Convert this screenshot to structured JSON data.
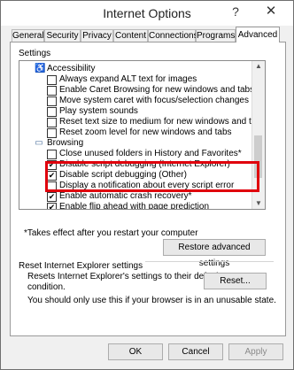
{
  "window": {
    "title": "Internet Options",
    "help_icon": "?",
    "close_icon": "✕"
  },
  "tabs": [
    "General",
    "Security",
    "Privacy",
    "Content",
    "Connections",
    "Programs",
    "Advanced"
  ],
  "active_tab": "Advanced",
  "settings": {
    "label": "Settings",
    "items": [
      {
        "type": "category",
        "icon": "accessibility-icon",
        "label": "Accessibility"
      },
      {
        "type": "check",
        "checked": false,
        "label": "Always expand ALT text for images"
      },
      {
        "type": "check",
        "checked": false,
        "label": "Enable Caret Browsing for new windows and tabs"
      },
      {
        "type": "check",
        "checked": false,
        "label": "Move system caret with focus/selection changes"
      },
      {
        "type": "check",
        "checked": false,
        "label": "Play system sounds"
      },
      {
        "type": "check",
        "checked": false,
        "label": "Reset text size to medium for new windows and tabs"
      },
      {
        "type": "check",
        "checked": false,
        "label": "Reset zoom level for new windows and tabs"
      },
      {
        "type": "category",
        "icon": "browsing-icon",
        "label": "Browsing"
      },
      {
        "type": "check",
        "checked": false,
        "label": "Close unused folders in History and Favorites*"
      },
      {
        "type": "check",
        "checked": true,
        "label": "Disable script debugging (Internet Explorer)"
      },
      {
        "type": "check",
        "checked": true,
        "label": "Disable script debugging (Other)"
      },
      {
        "type": "check",
        "checked": false,
        "label": "Display a notification about every script error"
      },
      {
        "type": "check",
        "checked": true,
        "label": "Enable automatic crash recovery*"
      },
      {
        "type": "check",
        "checked": true,
        "label": "Enable flip ahead with page prediction"
      }
    ],
    "note": "*Takes effect after you restart your computer",
    "restore_button": "Restore advanced settings",
    "highlight_color": "#e0000c"
  },
  "reset": {
    "label": "Reset Internet Explorer settings",
    "description_line1": "Resets Internet Explorer's settings to their default",
    "description_line2": "condition.",
    "button": "Reset...",
    "warning": "You should only use this if your browser is in an unusable state."
  },
  "footer": {
    "ok": "OK",
    "cancel": "Cancel",
    "apply": "Apply"
  }
}
